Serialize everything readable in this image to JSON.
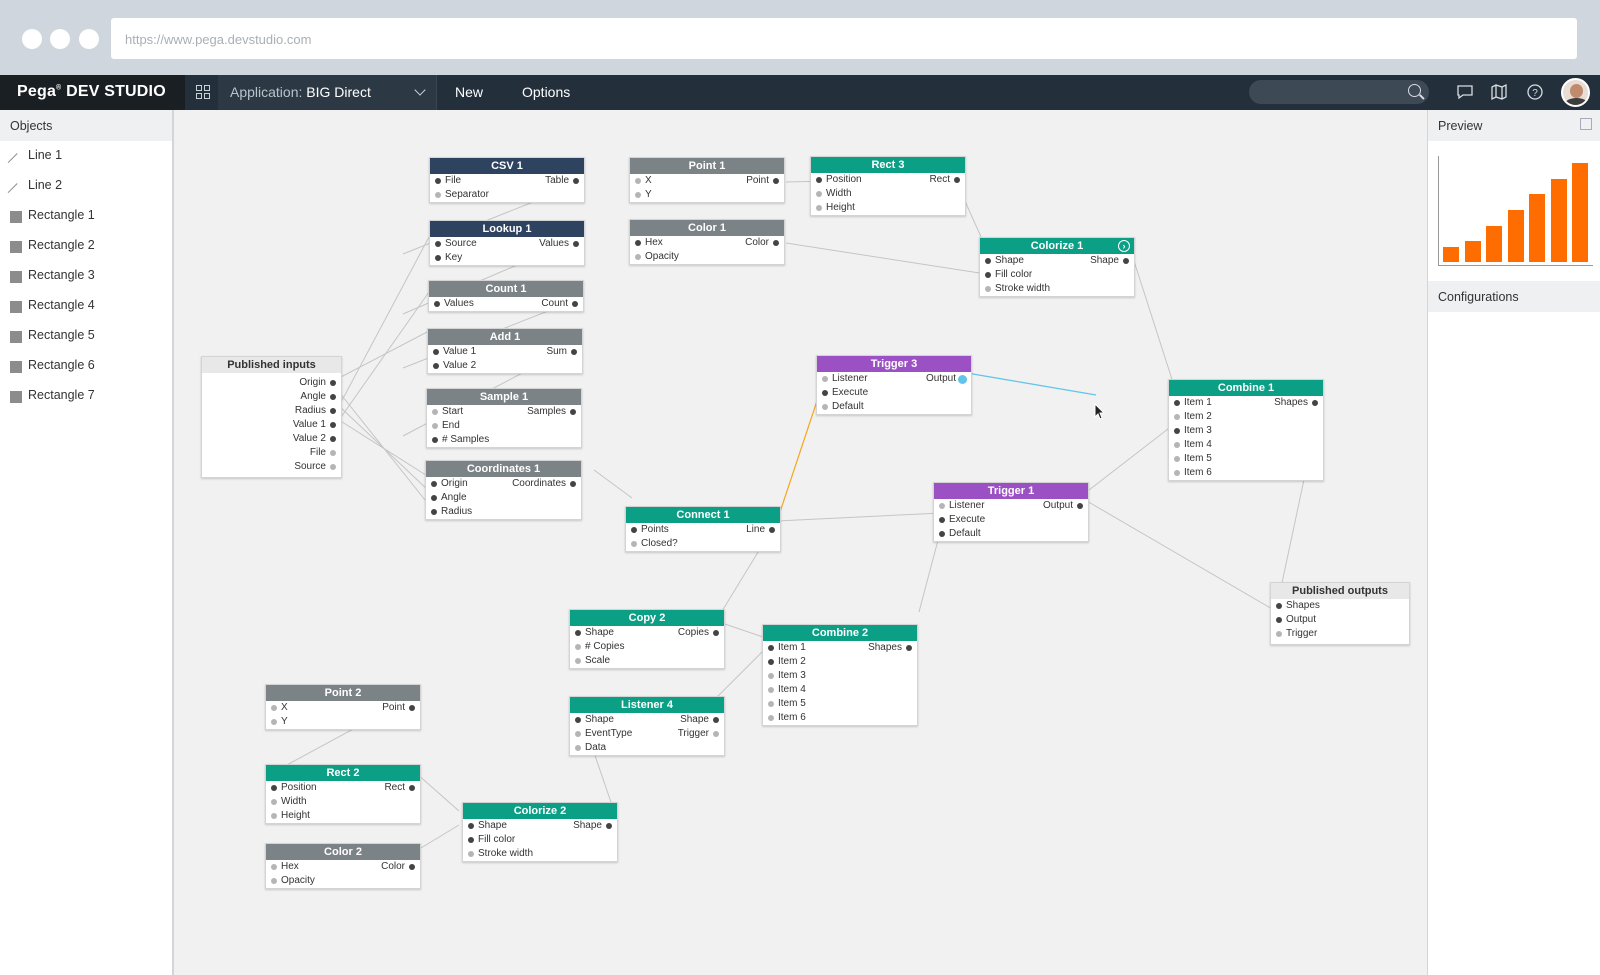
{
  "browser": {
    "url": "https://www.pega.devstudio.com"
  },
  "topbar": {
    "brand": "Pega",
    "brand_reg": "®",
    "brand_product": "DEV STUDIO",
    "app_prefix": "Application:",
    "app_name": "BIG Direct",
    "menu_new": "New",
    "menu_options": "Options",
    "search_placeholder": ""
  },
  "objects_panel": {
    "title": "Objects",
    "items": [
      {
        "label": "Line 1",
        "icon": "line-icon"
      },
      {
        "label": "Line 2",
        "icon": "line-icon"
      },
      {
        "label": "Rectangle 1",
        "icon": "rect-icon"
      },
      {
        "label": "Rectangle 2",
        "icon": "rect-icon"
      },
      {
        "label": "Rectangle 3",
        "icon": "rect-icon"
      },
      {
        "label": "Rectangle 4",
        "icon": "rect-icon"
      },
      {
        "label": "Rectangle 5",
        "icon": "rect-icon"
      },
      {
        "label": "Rectangle 6",
        "icon": "rect-icon"
      },
      {
        "label": "Rectangle 7",
        "icon": "rect-icon"
      }
    ]
  },
  "right_panel": {
    "preview_title": "Preview",
    "config_title": "Configurations",
    "preview_bar_fractions": [
      0.14,
      0.2,
      0.35,
      0.5,
      0.65,
      0.8,
      0.95
    ],
    "bar_color": "#ff6d00"
  },
  "colors": {
    "navy": "#2d4360",
    "gray": "#7c8387",
    "teal": "#0b9f86",
    "purple": "#9b51c4",
    "wire_orange": "#f5a623",
    "wire_blue": "#62c4ea"
  },
  "nodes": {
    "csv1": {
      "title": "CSV 1",
      "rows": [
        [
          "File",
          "Table"
        ],
        [
          "Separator",
          ""
        ]
      ]
    },
    "lookup1": {
      "title": "Lookup 1",
      "rows": [
        [
          "Source",
          "Values"
        ],
        [
          "Key",
          ""
        ]
      ]
    },
    "count1": {
      "title": "Count 1",
      "rows": [
        [
          "Values",
          "Count"
        ]
      ]
    },
    "add1": {
      "title": "Add 1",
      "rows": [
        [
          "Value 1",
          "Sum"
        ],
        [
          "Value 2",
          ""
        ]
      ]
    },
    "sample1": {
      "title": "Sample 1",
      "rows": [
        [
          "Start",
          "Samples"
        ],
        [
          "End",
          ""
        ],
        [
          "# Samples",
          ""
        ]
      ]
    },
    "coords1": {
      "title": "Coordinates 1",
      "rows": [
        [
          "Origin",
          "Coordinates"
        ],
        [
          "Angle",
          ""
        ],
        [
          "Radius",
          ""
        ]
      ]
    },
    "published_inputs": {
      "title": "Published inputs",
      "rows": [
        "Origin",
        "Angle",
        "Radius",
        "Value 1",
        "Value 2",
        "File",
        "Source"
      ]
    },
    "point1": {
      "title": "Point 1",
      "rows": [
        [
          "X",
          "Point"
        ],
        [
          "Y",
          ""
        ]
      ]
    },
    "color1": {
      "title": "Color 1",
      "rows": [
        [
          "Hex",
          "Color"
        ],
        [
          "Opacity",
          ""
        ]
      ]
    },
    "rect3": {
      "title": "Rect 3",
      "rows": [
        [
          "Position",
          "Rect"
        ],
        [
          "Width",
          ""
        ],
        [
          "Height",
          ""
        ]
      ]
    },
    "colorize1": {
      "title": "Colorize 1",
      "rows": [
        [
          "Shape",
          "Shape"
        ],
        [
          "Fill color",
          ""
        ],
        [
          "Stroke width",
          ""
        ]
      ]
    },
    "trigger3": {
      "title": "Trigger 3",
      "rows": [
        [
          "Listener",
          "Output"
        ],
        [
          "Execute",
          ""
        ],
        [
          "Default",
          ""
        ]
      ]
    },
    "combine1": {
      "title": "Combine 1",
      "rows": [
        [
          "Item 1",
          "Shapes"
        ],
        [
          "Item 2",
          ""
        ],
        [
          "Item 3",
          ""
        ],
        [
          "Item 4",
          ""
        ],
        [
          "Item 5",
          ""
        ],
        [
          "Item 6",
          ""
        ]
      ]
    },
    "connect1": {
      "title": "Connect 1",
      "rows": [
        [
          "Points",
          "Line"
        ],
        [
          "Closed?",
          ""
        ]
      ]
    },
    "trigger1": {
      "title": "Trigger 1",
      "rows": [
        [
          "Listener",
          "Output"
        ],
        [
          "Execute",
          ""
        ],
        [
          "Default",
          ""
        ]
      ]
    },
    "published_outputs": {
      "title": "Published outputs",
      "rows": [
        "Shapes",
        "Output",
        "Trigger"
      ]
    },
    "copy2": {
      "title": "Copy 2",
      "rows": [
        [
          "Shape",
          "Copies"
        ],
        [
          "# Copies",
          ""
        ],
        [
          "Scale",
          ""
        ]
      ]
    },
    "combine2": {
      "title": "Combine 2",
      "rows": [
        [
          "Item 1",
          "Shapes"
        ],
        [
          "Item 2",
          ""
        ],
        [
          "Item 3",
          ""
        ],
        [
          "Item 4",
          ""
        ],
        [
          "Item 5",
          ""
        ],
        [
          "Item 6",
          ""
        ]
      ]
    },
    "listener4": {
      "title": "Listener 4",
      "rows": [
        [
          "Shape",
          "Shape"
        ],
        [
          "EventType",
          "Trigger"
        ],
        [
          "Data",
          ""
        ]
      ]
    },
    "point2": {
      "title": "Point 2",
      "rows": [
        [
          "X",
          "Point"
        ],
        [
          "Y",
          ""
        ]
      ]
    },
    "rect2": {
      "title": "Rect 2",
      "rows": [
        [
          "Position",
          "Rect"
        ],
        [
          "Width",
          ""
        ],
        [
          "Height",
          ""
        ]
      ]
    },
    "color2": {
      "title": "Color 2",
      "rows": [
        [
          "Hex",
          "Color"
        ],
        [
          "Opacity",
          ""
        ]
      ]
    },
    "colorize2": {
      "title": "Colorize 2",
      "rows": [
        [
          "Shape",
          "Shape"
        ],
        [
          "Fill color",
          ""
        ],
        [
          "Stroke width",
          ""
        ]
      ]
    }
  }
}
